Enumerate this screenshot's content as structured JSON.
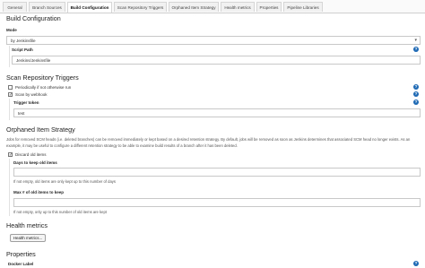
{
  "tabs": [
    "General",
    "Branch Sources",
    "Build Configuration",
    "Scan Repository Triggers",
    "Orphaned Item Strategy",
    "Health metrics",
    "Properties",
    "Pipeline Libraries"
  ],
  "active_tab": "Build Configuration",
  "build_config": {
    "title": "Build Configuration",
    "mode_label": "Mode",
    "mode_value": "by Jenkinsfile",
    "script_path_label": "Script Path",
    "script_path_value": "Jenkins/Jenkinsfile"
  },
  "scan_triggers": {
    "title": "Scan Repository Triggers",
    "periodic_label": "Periodically if not otherwise run",
    "periodic_checked": false,
    "webhook_label": "Scan by webhook",
    "webhook_checked": true,
    "trigger_token_label": "Trigger token",
    "trigger_token_value": "test"
  },
  "orphaned": {
    "title": "Orphaned Item Strategy",
    "description": "Jobs for removed SCM heads (i.e. deleted branches) can be removed immediately or kept based on a desired retention strategy. By default, jobs will be removed as soon as Jenkins determines that associated SCM head no longer exists. As an example, it may be useful to configure a different retention strategy to be able to examine build results of a branch after it has been deleted.",
    "discard_label": "Discard old items",
    "discard_checked": true,
    "days_label": "Days to keep old items",
    "days_value": "",
    "days_hint": "If not empty, old items are only kept up to this number of days",
    "max_label": "Max # of old items to keep",
    "max_value": "",
    "max_hint": "If not empty, only up to this number of old items are kept"
  },
  "health": {
    "title": "Health metrics",
    "button_label": "Health metrics..."
  },
  "properties": {
    "title": "Properties",
    "docker_label": "Docker Label"
  },
  "icons": {
    "help": "?",
    "check": "✓",
    "caret": "▾",
    "close": "×"
  },
  "colors": {
    "help_icon": "#1d69b4",
    "border": "#c8c8c8"
  }
}
